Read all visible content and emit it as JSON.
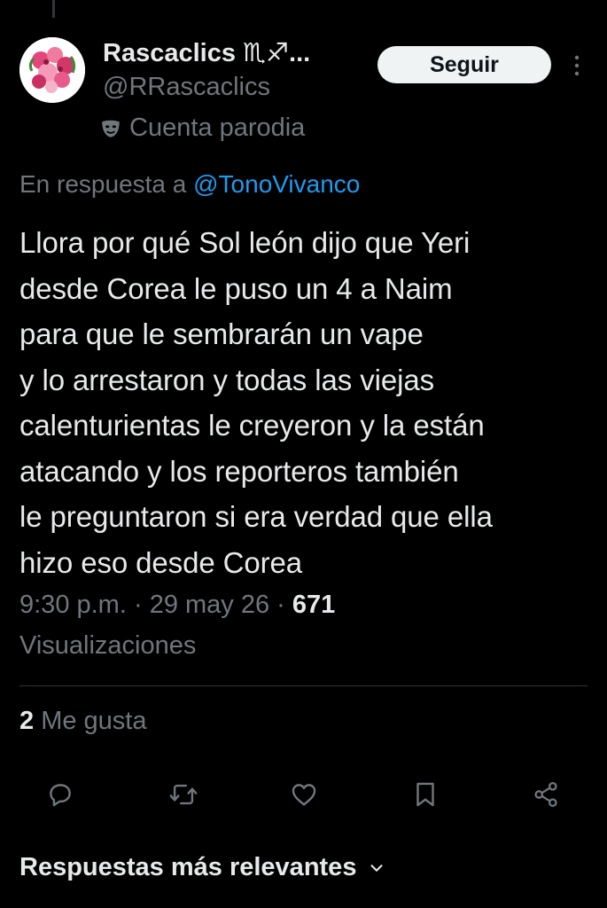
{
  "author": {
    "display_name": "Rascaclics ♏♐...",
    "handle": "@RRascaclics",
    "parody_label": "Cuenta parodia"
  },
  "follow_button": {
    "label": "Seguir"
  },
  "reply_context": {
    "prefix": "En respuesta a ",
    "mention": "@TonoVivanco"
  },
  "tweet": {
    "text": "Llora por qué Sol león dijo que Yeri\ndesde Corea le puso un 4 a Naim\npara que le sembrarán un vape\ny lo arrestaron y todas las viejas\ncalenturientas le creyeron y la están\natacando y los reporteros también\nle preguntaron si era verdad que ella\nhizo eso desde Corea",
    "time": "9:30 p.m.",
    "separator": " · ",
    "date": "29 may 26",
    "views_count": "671",
    "views_label": "Visualizaciones"
  },
  "engagement": {
    "likes_count": "2",
    "likes_label": " Me gusta"
  },
  "actions": [
    {
      "name": "reply",
      "icon": "reply-icon"
    },
    {
      "name": "retweet",
      "icon": "retweet-icon"
    },
    {
      "name": "like",
      "icon": "heart-icon"
    },
    {
      "name": "bookmark",
      "icon": "bookmark-icon"
    },
    {
      "name": "share",
      "icon": "share-icon"
    }
  ],
  "replies_sort": {
    "label": "Respuestas más relevantes"
  },
  "colors": {
    "background": "#000000",
    "primary_text": "#e7e9ea",
    "secondary_text": "#71767b",
    "link": "#1d9bf0",
    "button_bg": "#eff3f4",
    "divider": "#2f3336"
  }
}
